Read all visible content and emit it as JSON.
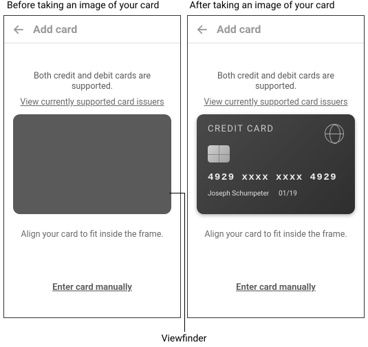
{
  "captions": {
    "before": "Before taking an image of your card",
    "after": "After taking an image of your card"
  },
  "header": {
    "title": "Add card"
  },
  "body": {
    "supportText": "Both credit and debit cards are supported.",
    "issuersLink": "View currently supported card issuers",
    "alignText": "Align your card to fit inside the frame.",
    "manualLink": "Enter card manually"
  },
  "card": {
    "label": "CREDIT CARD",
    "number": "4929 xxxx xxxx 4929",
    "name": "Joseph Schumpeter",
    "expiry": "01/19"
  },
  "annotation": {
    "viewfinder": "Viewfinder"
  }
}
